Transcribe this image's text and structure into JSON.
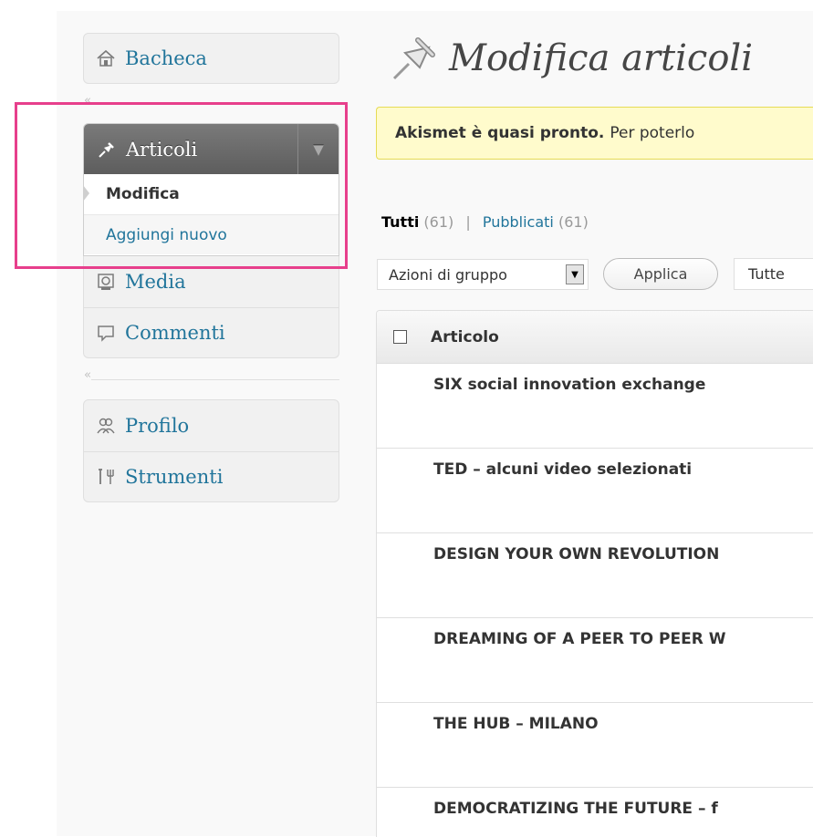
{
  "sidebar": {
    "top_group": [
      {
        "label": "Bacheca",
        "icon": "dashboard-icon"
      }
    ],
    "articoli": {
      "label": "Articoli",
      "icon": "pushpin-icon",
      "submenu": [
        {
          "label": "Modifica",
          "current": true
        },
        {
          "label": "Aggiungi nuovo",
          "current": false
        }
      ]
    },
    "mid_group": [
      {
        "label": "Media",
        "icon": "media-icon"
      },
      {
        "label": "Commenti",
        "icon": "comments-icon"
      }
    ],
    "bottom_group": [
      {
        "label": "Profilo",
        "icon": "users-icon"
      },
      {
        "label": "Strumenti",
        "icon": "tools-icon"
      }
    ],
    "collapse_glyph": "«"
  },
  "page": {
    "title": "Modifica articoli",
    "notice": {
      "bold": "Akismet è quasi pronto.",
      "text": "Per poterlo"
    },
    "filters": {
      "all_label": "Tutti",
      "all_count": "(61)",
      "separator": "|",
      "published_label": "Pubblicati",
      "published_count": "(61)"
    },
    "bulk_actions": {
      "selected": "Azioni di gruppo",
      "apply": "Applica"
    },
    "date_filter": {
      "selected": "Tutte"
    },
    "table": {
      "column_title": "Articolo",
      "rows": [
        "SIX social innovation exchange",
        "TED – alcuni video selezionati",
        "DESIGN YOUR OWN REVOLUTION",
        "DREAMING OF A PEER TO PEER W",
        "THE HUB – MILANO",
        "DEMOCRATIZING THE FUTURE – f"
      ]
    }
  },
  "colors": {
    "link": "#21759b",
    "highlight_box": "#e73f8c",
    "notice_bg": "#fffbcc",
    "notice_border": "#e6db55",
    "active_menu_bg": "#6a6a6a"
  }
}
